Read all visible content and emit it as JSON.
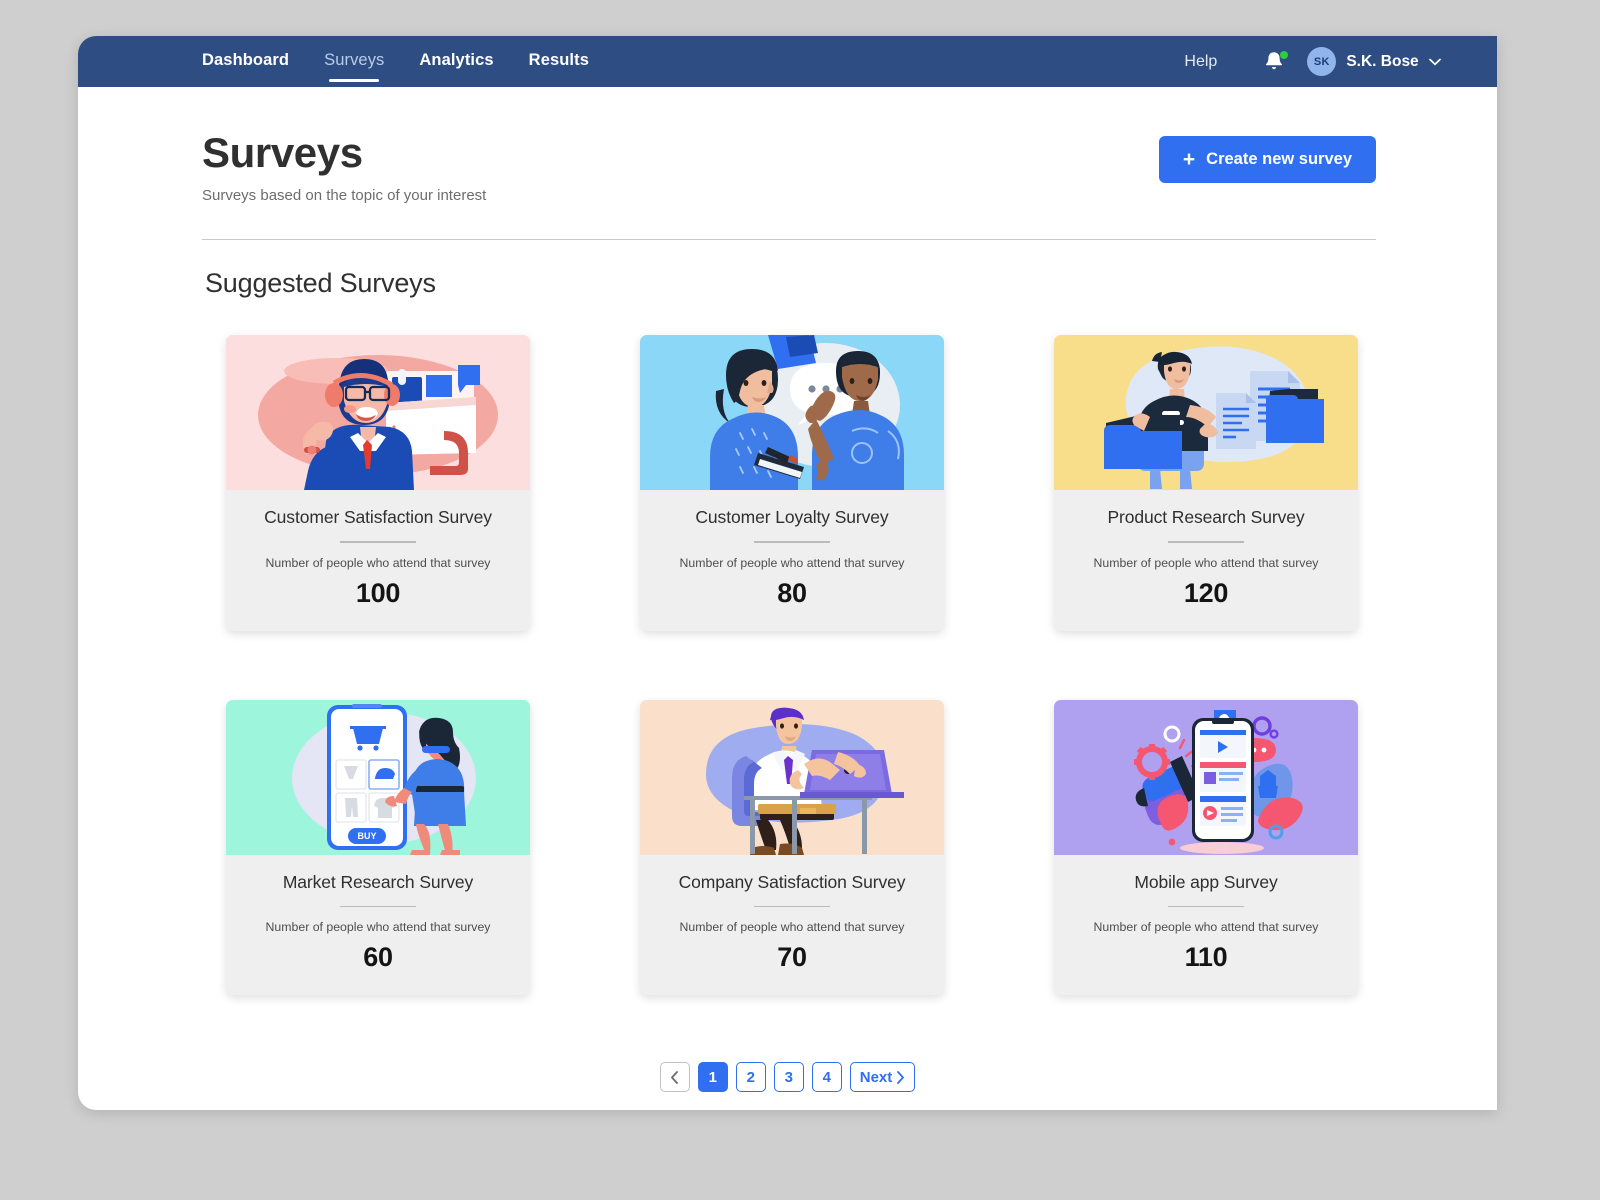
{
  "nav": {
    "links": [
      {
        "label": "Dashboard",
        "active": false
      },
      {
        "label": "Surveys",
        "active": true
      },
      {
        "label": "Analytics",
        "active": false
      },
      {
        "label": "Results",
        "active": false
      }
    ],
    "help_label": "Help",
    "notification_icon": "bell-icon",
    "notification_dot_color": "#2ecc40",
    "avatar_initials": "SK",
    "user_name": "S.K. Bose",
    "chevron": "⌄"
  },
  "header": {
    "title": "Surveys",
    "subtitle": "Surveys based on the topic of your interest",
    "create_button": {
      "label": "Create new survey",
      "icon": "plus-icon",
      "color": "#2f6ff0"
    }
  },
  "section": {
    "title": "Suggested Surveys"
  },
  "cards": [
    {
      "title": "Customer Satisfaction Survey",
      "caption": "Number of people who attend that survey",
      "value": "100",
      "art_bg": "#fcdede",
      "art": "support-agent-illustration"
    },
    {
      "title": "Customer Loyalty Survey",
      "caption": "Number of people who attend that survey",
      "value": "80",
      "art_bg": "#8ad7f8",
      "art": "two-people-talking-illustration"
    },
    {
      "title": "Product Research Survey",
      "caption": "Number of people who attend that survey",
      "value": "120",
      "art_bg": "#f8dd8a",
      "art": "man-with-documents-illustration"
    },
    {
      "title": "Market Research Survey",
      "caption": "Number of people who attend that survey",
      "value": "60",
      "art_bg": "#9df5dc",
      "art": "woman-shopping-phone-illustration"
    },
    {
      "title": "Company Satisfaction Survey",
      "caption": "Number of people who attend that survey",
      "value": "70",
      "art_bg": "#fae0cb",
      "art": "man-at-desk-laptop-illustration"
    },
    {
      "title": "Mobile app Survey",
      "caption": "Number of people who attend that survey",
      "value": "110",
      "art_bg": "#b0a0f0",
      "art": "mobile-app-marketing-illustration"
    }
  ],
  "pagination": {
    "prev_label": "‹",
    "pages": [
      {
        "label": "1",
        "active": true
      },
      {
        "label": "2",
        "active": false
      },
      {
        "label": "3",
        "active": false
      },
      {
        "label": "4",
        "active": false
      }
    ],
    "next_label": "Next",
    "next_icon": "chevron-right-icon"
  },
  "theme": {
    "navbar": "#2e4d82",
    "accent": "#2f6ff0",
    "card_body": "#efefef",
    "page_bg": "#cfcfcf"
  }
}
